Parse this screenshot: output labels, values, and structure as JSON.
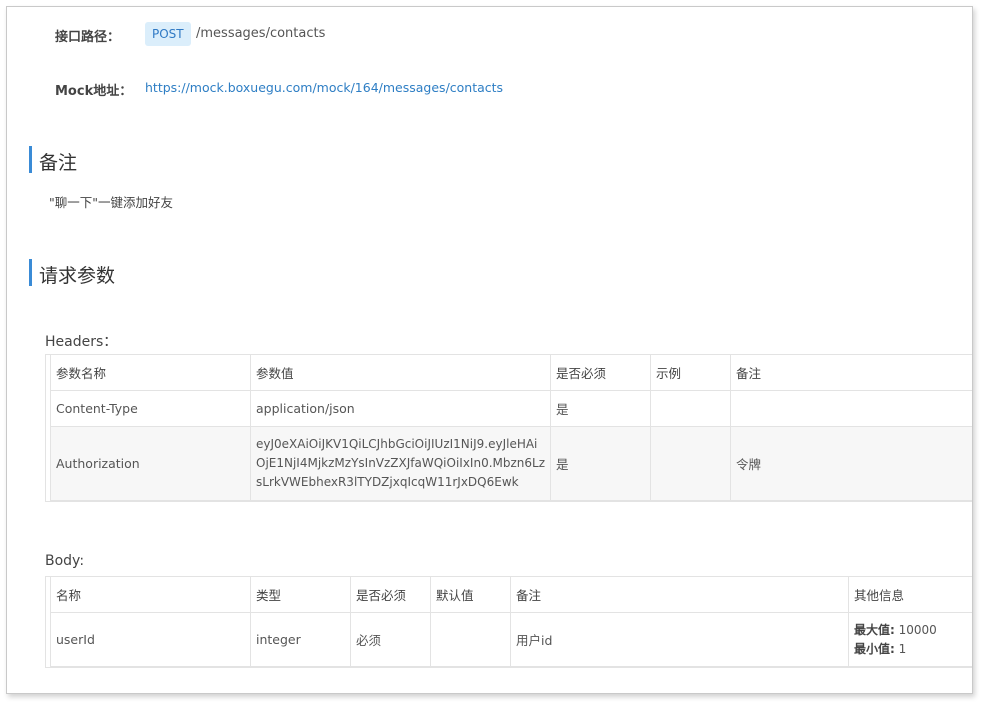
{
  "api": {
    "path_label": "接口路径：",
    "method": "POST",
    "path": "/messages/contacts",
    "mock_label": "Mock地址：",
    "mock_url": "https://mock.boxuegu.com/mock/164/messages/contacts"
  },
  "remarks": {
    "title": "备注",
    "text": "\"聊一下\"一键添加好友"
  },
  "request": {
    "title": "请求参数",
    "headers_title": "Headers：",
    "headers_columns": [
      "参数名称",
      "参数值",
      "是否必须",
      "示例",
      "备注"
    ],
    "headers_rows": [
      [
        "Content-Type",
        "application/json",
        "是",
        "",
        ""
      ],
      [
        "Authorization",
        "eyJ0eXAiOiJKV1QiLCJhbGciOiJIUzI1NiJ9.eyJleHAiOjE1NjI4MjkzMzYsInVzZXJfaWQiOiIxIn0.Mbzn6LzsLrkVWEbhexR3lTYDZjxqIcqW11rJxDQ6Ewk",
        "是",
        "",
        "令牌"
      ]
    ],
    "body_title": "Body:",
    "body_columns": [
      "名称",
      "类型",
      "是否必须",
      "默认值",
      "备注",
      "其他信息"
    ],
    "body_rows": [
      {
        "name": "userId",
        "type": "integer",
        "required": "必须",
        "default": "",
        "remark": "用户id",
        "max_label": "最大值:",
        "max_value": "10000",
        "min_label": "最小值:",
        "min_value": "1"
      }
    ]
  }
}
